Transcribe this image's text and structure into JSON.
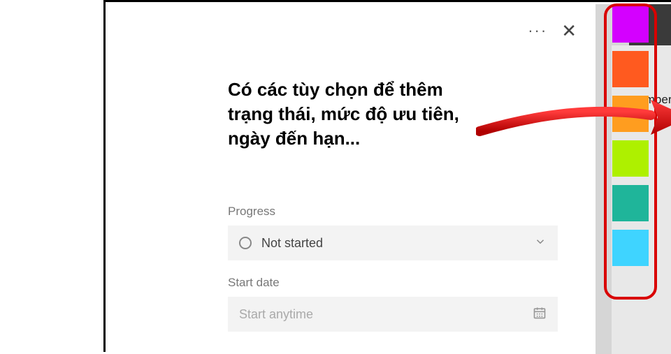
{
  "header": {
    "more_label": "···",
    "close_label": "✕"
  },
  "annotation": "Có các tùy chọn để thêm trạng thái, mức độ ưu tiên, ngày đến hạn...",
  "form": {
    "progress_label": "Progress",
    "progress_value": "Not started",
    "start_date_label": "Start date",
    "start_date_placeholder": "Start anytime"
  },
  "right_hint": "mbers",
  "swatches": [
    {
      "name": "magenta",
      "color": "#d400ff"
    },
    {
      "name": "orange-red",
      "color": "#ff5a1f"
    },
    {
      "name": "orange",
      "color": "#ff9d1f"
    },
    {
      "name": "lime",
      "color": "#aef000"
    },
    {
      "name": "teal",
      "color": "#1fb59a"
    },
    {
      "name": "cyan",
      "color": "#3fd4ff"
    }
  ]
}
